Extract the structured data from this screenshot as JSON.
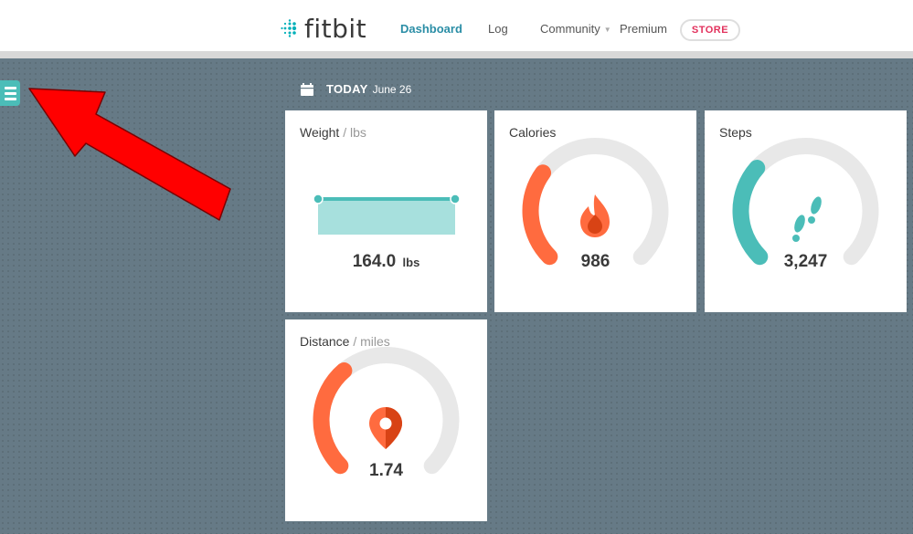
{
  "header": {
    "logo_text": "fitbit",
    "nav": {
      "dashboard": "Dashboard",
      "log": "Log",
      "community": "Community",
      "premium": "Premium"
    },
    "store_label": "STORE"
  },
  "date_bar": {
    "today": "TODAY",
    "date": "June 26"
  },
  "tiles": {
    "weight": {
      "title": "Weight",
      "unit": "/ lbs",
      "value": "164.0",
      "value_unit": "lbs"
    },
    "calories": {
      "title": "Calories",
      "value": "986",
      "progress": 0.3
    },
    "steps": {
      "title": "Steps",
      "value": "3,247",
      "progress": 0.32
    },
    "distance": {
      "title": "Distance",
      "unit": "/ miles",
      "value": "1.74",
      "progress": 0.35
    }
  },
  "colors": {
    "accent_teal": "#4bbdb8",
    "accent_orange": "#ff6b3f",
    "nav_active": "#2b8ea6",
    "store_pink": "#e2315c",
    "annotation_red": "#ff0000"
  },
  "icons": {
    "menu": "hamburger-icon",
    "calendar": "calendar-icon",
    "calories": "flame-icon",
    "steps": "footprints-icon",
    "distance": "location-pin-icon",
    "annotation": "red-arrow-annotation"
  }
}
